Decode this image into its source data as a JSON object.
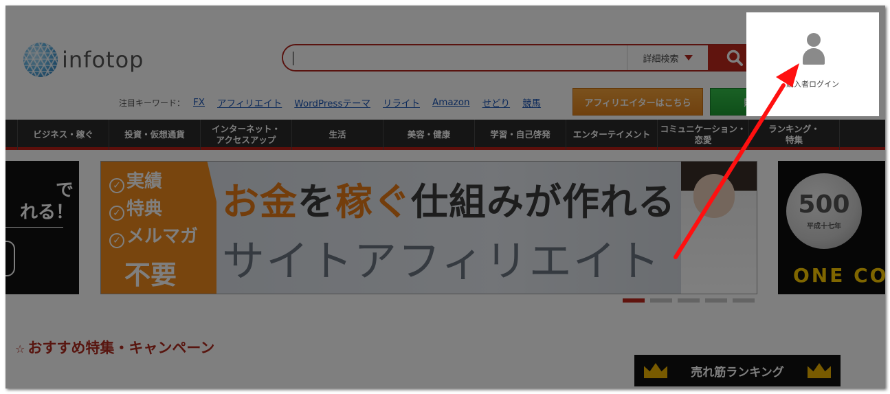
{
  "header": {
    "logo_text": "infotop",
    "search": {
      "placeholder": "",
      "advanced_label": "詳細検索"
    }
  },
  "keywords": {
    "label": "注目キーワード：",
    "items": [
      "FX",
      "アフィリエイト",
      "WordPressテーマ",
      "リライト",
      "Amazon",
      "せどり",
      "競馬"
    ]
  },
  "buttons": {
    "affiliate": "アフィリエイターはこちら",
    "seller": "販売者はこちら"
  },
  "nav": {
    "items": [
      "ビジネス・稼ぐ",
      "投資・仮想通貨",
      "インターネット・\nアクセスアップ",
      "生活",
      "美容・健康",
      "学習・自己啓発",
      "エンターテイメント",
      "コミュニケーション・\n恋愛",
      "ランキング・\n特集"
    ]
  },
  "carousel": {
    "left": {
      "line1": "で",
      "line2": "れる！"
    },
    "main": {
      "badge_items": [
        "実績",
        "特典",
        "メルマガ"
      ],
      "badge_bottom": "不要",
      "headline_part1": "お金",
      "headline_part2": "を",
      "headline_part3": "稼ぐ",
      "headline_part4": "仕組みが作れる",
      "headline2": "サイトアフィリエイト"
    },
    "right": {
      "coin_value": "500",
      "coin_sub": "平成十七年",
      "caption": "ONE CO"
    },
    "active_index": 0,
    "dot_count": 5
  },
  "feature": {
    "star": "☆",
    "title": "おすすめ特集・キャンペーン"
  },
  "ranking": {
    "title": "売れ筋ランキング"
  },
  "login": {
    "label": "購入者ログイン"
  },
  "colors": {
    "accent": "#c0281c",
    "affiliate": "#e0821c",
    "seller": "#1f9e33",
    "annotation_arrow": "#ff0000"
  }
}
